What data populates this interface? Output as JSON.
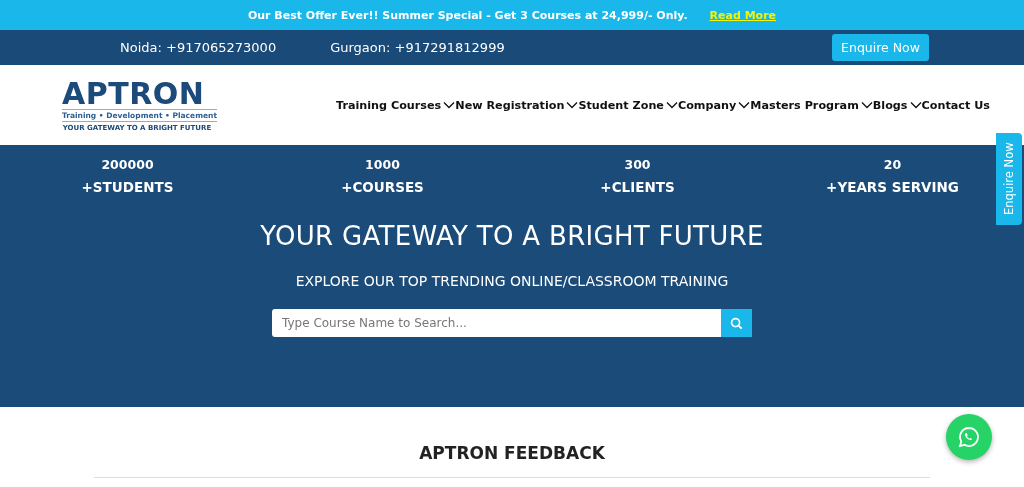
{
  "offer_bar": {
    "text": "Our Best Offer Ever!! Summer Special - Get 3 Courses at 24,999/- Only.",
    "link": "Read More"
  },
  "contact_bar": {
    "phones": [
      "Noida: +917065273000",
      "Gurgaon: +917291812999"
    ],
    "button": "Enquire Now"
  },
  "logo": {
    "name": "APTRON",
    "tagline": "Training • Development • Placement",
    "slogan": "YOUR GATEWAY TO A BRIGHT FUTURE"
  },
  "nav": [
    {
      "label": "Training Courses",
      "dropdown": true
    },
    {
      "label": "New Registration",
      "dropdown": true
    },
    {
      "label": "Student Zone",
      "dropdown": true
    },
    {
      "label": "Company",
      "dropdown": true
    },
    {
      "label": "Masters Program",
      "dropdown": true
    },
    {
      "label": "Blogs",
      "dropdown": true
    },
    {
      "label": "Contact Us",
      "dropdown": false
    }
  ],
  "stats": [
    {
      "value": "200000",
      "label": "+STUDENTS"
    },
    {
      "value": "1000",
      "label": "+COURSES"
    },
    {
      "value": "300",
      "label": "+CLIENTS"
    },
    {
      "value": "20",
      "label": "+YEARS SERVING"
    }
  ],
  "hero": {
    "title": "YOUR GATEWAY TO A BRIGHT FUTURE",
    "subtitle": "EXPLORE OUR TOP TRENDING ONLINE/CLASSROOM TRAINING",
    "search": {
      "placeholder": "Type Course Name to Search..."
    }
  },
  "side_tab": "Enquire Now",
  "feedback": {
    "title": "APTRON FEEDBACK"
  }
}
